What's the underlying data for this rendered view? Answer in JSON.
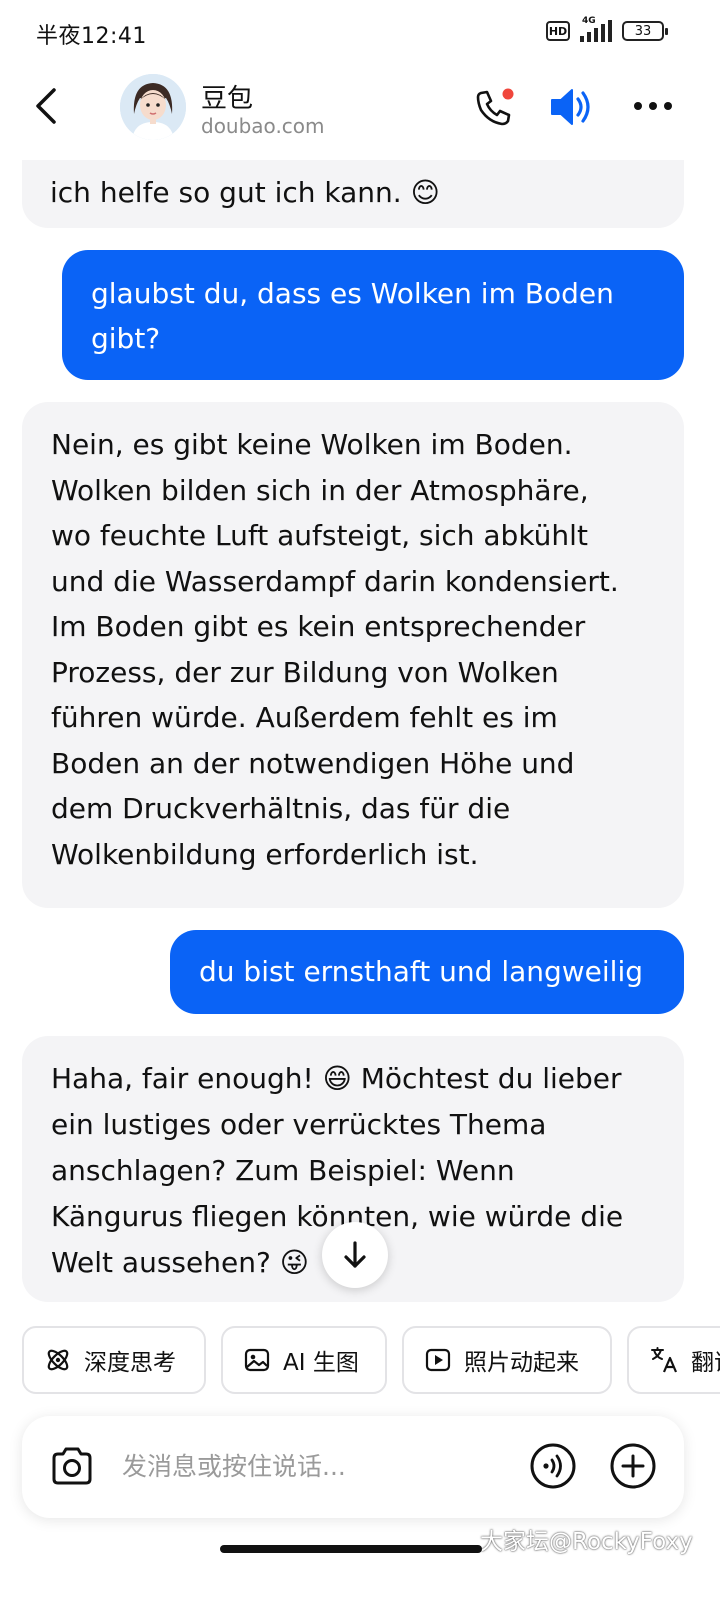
{
  "status_bar": {
    "time": "半夜12:41",
    "hd": "HD",
    "network": "4G",
    "battery": "33"
  },
  "header": {
    "name": "豆包",
    "domain": "doubao.com"
  },
  "colors": {
    "accent": "#0a63f6",
    "bot_bubble": "#f4f4f6",
    "notification_dot": "#f0463c"
  },
  "messages": [
    {
      "role": "bot",
      "lines": [
        "ich helfe so gut ich kann. 😊"
      ]
    },
    {
      "role": "user",
      "lines": [
        "glaubst du, dass es Wolken im Boden",
        "gibt?"
      ]
    },
    {
      "role": "bot",
      "lines": [
        "Nein, es gibt keine Wolken im Boden.",
        "Wolken bilden sich in der Atmosphäre,",
        "wo feuchte Luft aufsteigt, sich abkühlt",
        "und die Wasserdampf darin kondensiert.",
        "Im Boden gibt es kein entsprechender",
        "Prozess, der zur Bildung von Wolken",
        "führen würde. Außerdem fehlt es im",
        "Boden an der notwendigen Höhe und",
        "dem Druckverhältnis, das für die",
        "Wolkenbildung erforderlich ist."
      ]
    },
    {
      "role": "user",
      "lines": [
        "du bist ernsthaft und langweilig"
      ]
    },
    {
      "role": "bot",
      "lines": [
        "Haha, fair enough! 😄 Möchtest du lieber",
        "ein lustiges oder verrücktes Thema",
        "anschlagen? Zum Beispiel: Wenn",
        "Kängurus fliegen könnten, wie würde die",
        "Welt aussehen? 😜"
      ]
    }
  ],
  "chips": [
    {
      "label": "深度思考",
      "icon": "atom-icon"
    },
    {
      "label": "AI 生图",
      "icon": "image-icon"
    },
    {
      "label": "照片动起来",
      "icon": "play-icon"
    },
    {
      "label": "翻译",
      "icon": "translate-icon"
    }
  ],
  "input": {
    "placeholder": "发消息或按住说话..."
  },
  "watermark": "大家坛@RockyFoxy"
}
